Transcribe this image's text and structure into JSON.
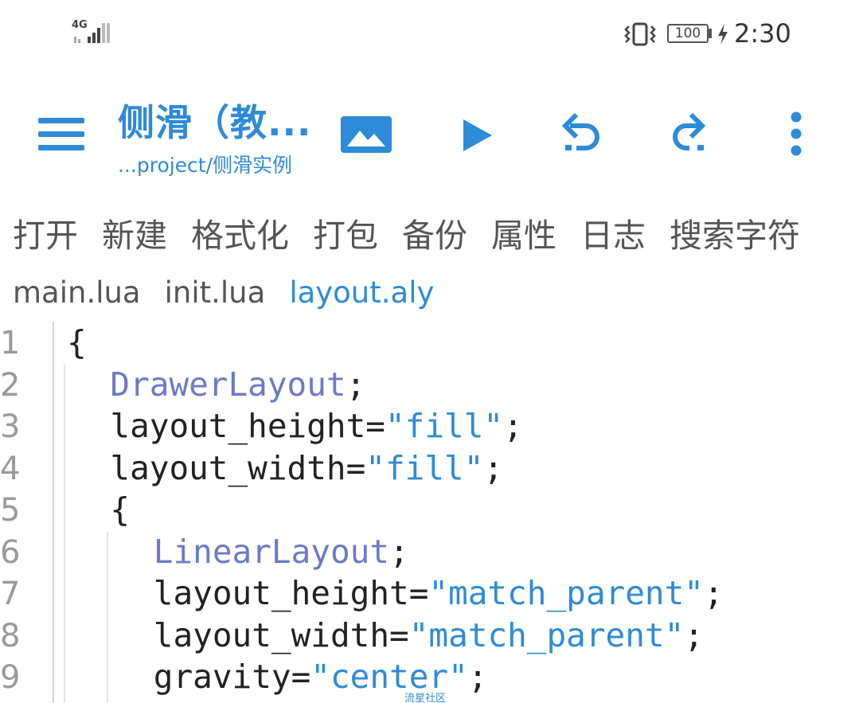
{
  "status_bar": {
    "network": "4G",
    "battery": "100",
    "time": "2:30"
  },
  "toolbar": {
    "title": "侧滑（教...",
    "subtitle": "...project/侧滑实例"
  },
  "menu": [
    "打开",
    "新建",
    "格式化",
    "打包",
    "备份",
    "属性",
    "日志",
    "搜索字符"
  ],
  "tabs": [
    {
      "label": "main.lua",
      "active": false
    },
    {
      "label": "init.lua",
      "active": false
    },
    {
      "label": "layout.aly",
      "active": true
    }
  ],
  "code_lines": [
    {
      "num": "1",
      "indent": "",
      "parts": [
        {
          "t": "{",
          "c": "plain"
        }
      ]
    },
    {
      "num": "2",
      "indent": "  ",
      "parts": [
        {
          "t": "DrawerLayout",
          "c": "kw"
        },
        {
          "t": ";",
          "c": "plain"
        }
      ]
    },
    {
      "num": "3",
      "indent": "  ",
      "parts": [
        {
          "t": "layout_height=",
          "c": "plain"
        },
        {
          "t": "\"fill\"",
          "c": "str"
        },
        {
          "t": ";",
          "c": "plain"
        }
      ]
    },
    {
      "num": "4",
      "indent": "  ",
      "parts": [
        {
          "t": "layout_width=",
          "c": "plain"
        },
        {
          "t": "\"fill\"",
          "c": "str"
        },
        {
          "t": ";",
          "c": "plain"
        }
      ]
    },
    {
      "num": "5",
      "indent": "  ",
      "parts": [
        {
          "t": "{",
          "c": "plain"
        }
      ]
    },
    {
      "num": "6",
      "indent": "    ",
      "parts": [
        {
          "t": "LinearLayout",
          "c": "kw"
        },
        {
          "t": ";",
          "c": "plain"
        }
      ]
    },
    {
      "num": "7",
      "indent": "    ",
      "parts": [
        {
          "t": "layout_height=",
          "c": "plain"
        },
        {
          "t": "\"match_parent\"",
          "c": "str"
        },
        {
          "t": ";",
          "c": "plain"
        }
      ]
    },
    {
      "num": "8",
      "indent": "    ",
      "parts": [
        {
          "t": "layout_width=",
          "c": "plain"
        },
        {
          "t": "\"match_parent\"",
          "c": "str"
        },
        {
          "t": ";",
          "c": "plain"
        }
      ]
    },
    {
      "num": "9",
      "indent": "    ",
      "parts": [
        {
          "t": "gravity=",
          "c": "plain"
        },
        {
          "t": "\"center\"",
          "c": "str"
        },
        {
          "t": ";",
          "c": "plain"
        }
      ]
    }
  ],
  "watermark": "流星社区",
  "colors": {
    "accent": "#2e8bd8",
    "keyword": "#6d7ac8",
    "text": "#222222",
    "line_number": "#9a9a9a"
  },
  "icons": [
    "menu-icon",
    "image-icon",
    "play-icon",
    "undo-icon",
    "redo-icon",
    "more-vert-icon",
    "vibrate-icon",
    "charging-icon",
    "signal-icon"
  ]
}
